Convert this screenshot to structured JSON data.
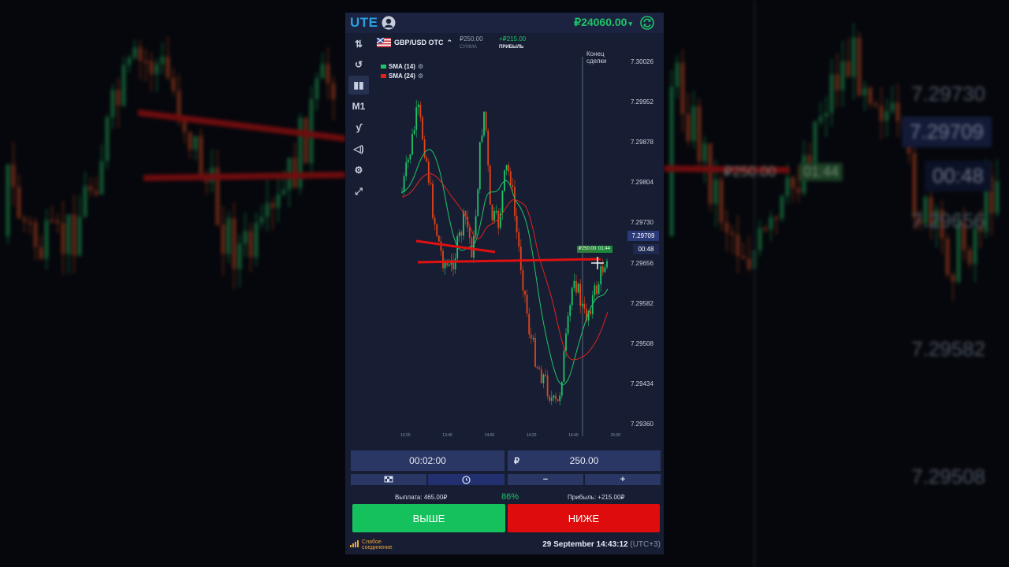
{
  "app": {
    "logo": "UTE",
    "balance": "₽24060.00",
    "balance_caret": "▾"
  },
  "asset": {
    "name": "GBP/USD OTC",
    "caret": "⌃",
    "sum_value": "₽250.00",
    "sum_caption": "СУММА",
    "profit_value": "+₽215.00",
    "profit_caption": "ПРИБЫЛЬ"
  },
  "indicators": [
    {
      "label": "SMA (14)",
      "color": "#1ec467"
    },
    {
      "label": "SMA (24)",
      "color": "#e0221b"
    }
  ],
  "deal_end": {
    "line1": "Конец",
    "line2": "сделки"
  },
  "toolbar": {
    "items": [
      {
        "name": "sort-icon",
        "glyph": "⇅"
      },
      {
        "name": "history-icon",
        "glyph": "↺"
      },
      {
        "name": "chart-type-icon",
        "glyph": "▮▮"
      },
      {
        "name": "timeframe-button",
        "glyph": "M1"
      },
      {
        "name": "drawing-icon",
        "glyph": "ƴ"
      },
      {
        "name": "sound-icon",
        "glyph": "◁)"
      },
      {
        "name": "settings-icon",
        "glyph": "⚙"
      },
      {
        "name": "fullscreen-icon",
        "glyph": "⤢"
      }
    ]
  },
  "chart": {
    "y_ticks": [
      "7.30026",
      "7.29952",
      "7.29878",
      "7.29804",
      "7.29730",
      "7.29656",
      "7.29582",
      "7.29508",
      "7.29434",
      "7.29360"
    ],
    "current_price": "7.29709",
    "countdown": "00:48",
    "trade_amount": "₽250.00",
    "trade_timer": "01:44",
    "x_ticks": [
      "13:20",
      "13:40",
      "14:00",
      "14:20",
      "14:40",
      "15:00"
    ]
  },
  "trade": {
    "duration": "00:02:00",
    "currency_symbol": "₽",
    "amount": "250.00",
    "payout": "Выплата: 465.00₽",
    "percent": "86%",
    "profit": "Прибыль: +215.00₽",
    "up_label": "ВЫШЕ",
    "down_label": "НИЖЕ",
    "minus": "−",
    "plus": "+"
  },
  "status": {
    "connection_line1": "Слабое",
    "connection_line2": "соединение",
    "datetime": "29 September 14:43:12",
    "timezone": "(UTC+3)"
  },
  "background": {
    "right_prices": [
      "7.29730",
      "7.29709",
      "00:48",
      "7.29656",
      "7.29582",
      "7.29508"
    ],
    "right_trade_amount": "₽250.00",
    "right_trade_timer": "01:44"
  },
  "colors": {
    "accent": "#28a0e2",
    "up": "#15c15d",
    "down": "#de0c0c",
    "panel": "#171e33",
    "field": "#2a3664"
  }
}
